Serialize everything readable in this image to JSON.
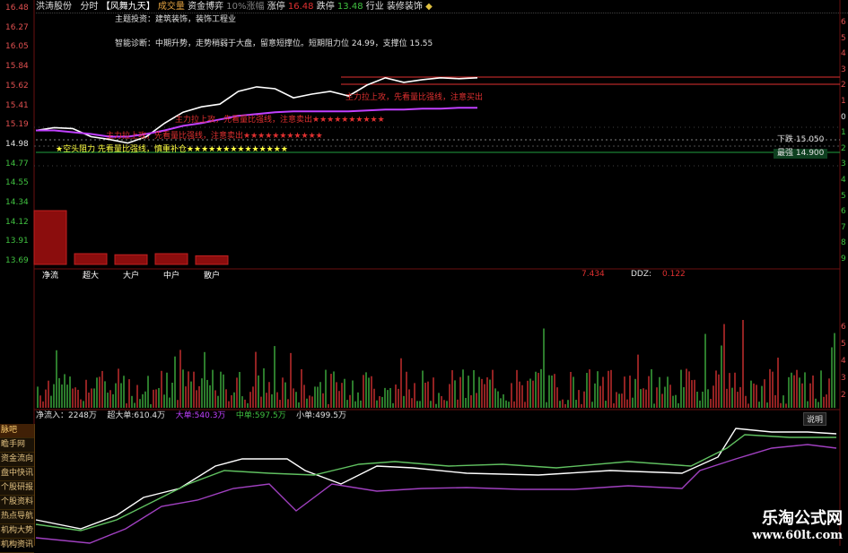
{
  "header": {
    "stock_name": "洪涛股份",
    "tab_timeshare": "分时",
    "indicator": "【风舞九天】",
    "mode_volume": "成交量",
    "mode_capital": "资金博弈",
    "limit_note": "10%涨幅",
    "limit_up_label": "涨停",
    "limit_up_value": "16.48",
    "limit_down_label": "跌停",
    "limit_down_value": "13.48",
    "industry_label": "行业",
    "industry_value": "装修装饰",
    "theme_line": "主题投资：建筑装饰，装饰工程业",
    "diagnosis_line": "智能诊断：中期升势，走势稍弱于大盘，留意短撑位。短期阻力位 24.99，支撑位 15.55"
  },
  "price_axis": {
    "ticks": [
      "16.48",
      "16.27",
      "16.05",
      "15.84",
      "15.62",
      "15.41",
      "15.19",
      "14.98",
      "14.77",
      "14.55",
      "14.34",
      "14.12",
      "13.91",
      "13.69"
    ]
  },
  "right_axis": {
    "ticks": [
      "6",
      "5",
      "4",
      "3",
      "2",
      "1",
      "0",
      "1",
      "2",
      "3",
      "4",
      "5",
      "6",
      "7",
      "8",
      "9"
    ]
  },
  "annotations": {
    "signal_1": "主力拉上攻，先看量比强线，注意买出",
    "signal_2": "主力拉上攻，先看量比强线，注意卖出★★★★★★★★★★",
    "signal_3": "主力拉上攻，先看量比强线，注意卖出★★★★★★★★★★★",
    "signal_4": "★空头阻力 先看量比强线，慎重补仓★★★★★★★★★★★★★★",
    "pressure_label": "下跌",
    "pressure_value": "15.050",
    "support_label": "最强",
    "support_value": "14.900"
  },
  "flow_bars": {
    "labels": [
      "净流",
      "超大",
      "大户",
      "中户",
      "散户"
    ],
    "values": [
      1.0,
      0.2,
      0.18,
      0.2,
      0.16
    ]
  },
  "ddz": {
    "left_value": "7.434",
    "label": "DDZ:",
    "value": "0.122"
  },
  "volume_axis": {
    "ticks": [
      "6",
      "5",
      "4",
      "3",
      "2"
    ]
  },
  "capital_legend": {
    "net_inflow": "净流入：2248万",
    "super_large": "超大单:610.4万",
    "large": "大单:540.3万",
    "medium": "中单:597.5万",
    "small": "小单:499.5万",
    "explain_button": "说明"
  },
  "sidebar": {
    "items": [
      "脉吧",
      "瞻手网",
      "资金流向",
      "盘中快讯",
      "个股研报",
      "个股资料",
      "热点导航",
      "机构大势",
      "机构资讯"
    ]
  },
  "watermark": {
    "line1": "乐淘公式网",
    "line2": "www.60lt.com"
  },
  "colors": {
    "price_line": "#ffffff",
    "avg_line": "#c040ff",
    "up": "#e03030",
    "down": "#40c040",
    "flow_bar": "#8b0d0d",
    "stars": "#ffff40",
    "support_box": "#20a040"
  },
  "chart_data": {
    "type": "line",
    "x": [
      0,
      10,
      20,
      30,
      40,
      50,
      60,
      70,
      80,
      90,
      100,
      110,
      120,
      130,
      140,
      150,
      160,
      170,
      180,
      190,
      200,
      210,
      220,
      230,
      240
    ],
    "series": [
      {
        "values": [
          15.12,
          15.15,
          15.14,
          15.05,
          15.02,
          14.98,
          15.05,
          15.2,
          15.32,
          15.38,
          15.41,
          15.55,
          15.6,
          15.58,
          15.48,
          15.52,
          15.55,
          15.5,
          15.62,
          15.7,
          15.65,
          15.68,
          15.7,
          15.69,
          15.7
        ]
      },
      {
        "values": [
          15.12,
          15.12,
          15.1,
          15.08,
          15.05,
          15.05,
          15.08,
          15.12,
          15.17,
          15.2,
          15.24,
          15.28,
          15.3,
          15.32,
          15.33,
          15.33,
          15.33,
          15.33,
          15.34,
          15.35,
          15.35,
          15.36,
          15.36,
          15.37,
          15.37
        ]
      }
    ]
  }
}
